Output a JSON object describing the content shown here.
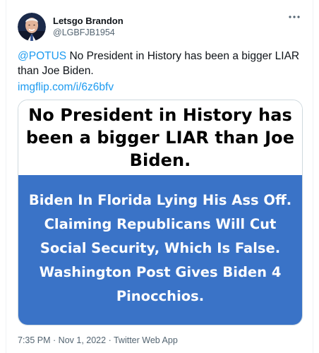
{
  "user": {
    "display_name": "Letsgo Brandon",
    "handle": "@LGBFJB1954"
  },
  "tweet": {
    "mention": "@POTUS",
    "text": " No President in History has been a bigger LIAR than Joe Biden.",
    "link": "imgflip.com/i/6z6bfv"
  },
  "meme": {
    "top_text": "No President in History has been a bigger LIAR than Joe Biden.",
    "bottom_text": "Biden In Florida Lying His Ass Off. Claiming Republicans Will Cut Social Security, Which Is False. Washington Post Gives Biden 4 Pinocchios."
  },
  "footer": {
    "time": "7:35 PM",
    "separator1": " · ",
    "date": "Nov 1, 2022",
    "separator2": " · ",
    "source": "Twitter Web App"
  },
  "icons": {
    "more": "more-options-icon"
  },
  "colors": {
    "link": "#1d9bf0",
    "meme_blue": "#3a73c7",
    "secondary_text": "#536471"
  }
}
